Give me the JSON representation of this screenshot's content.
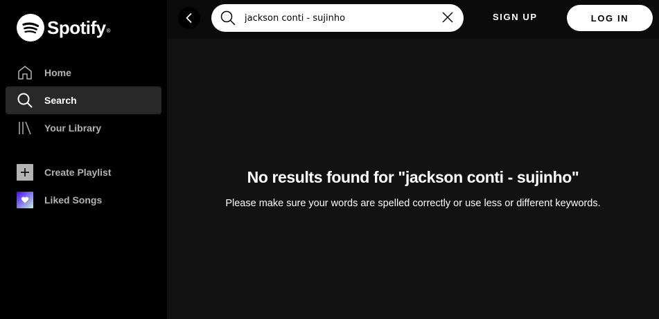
{
  "brand": {
    "name": "Spotify",
    "reg_mark": "®"
  },
  "sidebar": {
    "items": [
      {
        "label": "Home",
        "icon": "home-icon",
        "active": false
      },
      {
        "label": "Search",
        "icon": "search-icon",
        "active": true
      },
      {
        "label": "Your Library",
        "icon": "library-icon",
        "active": false
      }
    ],
    "playlist_items": [
      {
        "label": "Create Playlist",
        "icon": "plus-icon"
      },
      {
        "label": "Liked Songs",
        "icon": "heart-icon"
      }
    ]
  },
  "topbar": {
    "search_value": "jackson conti - sujinho",
    "signup_label": "SIGN UP",
    "login_label": "LOG IN"
  },
  "results": {
    "title": "No results found for \"jackson conti - sujinho\"",
    "hint": "Please make sure your words are spelled correctly or use less or different keywords."
  },
  "colors": {
    "sidebar_bg": "#000000",
    "main_bg": "#121212",
    "active_item_bg": "#282828",
    "inactive_text": "#b3b3b3"
  }
}
